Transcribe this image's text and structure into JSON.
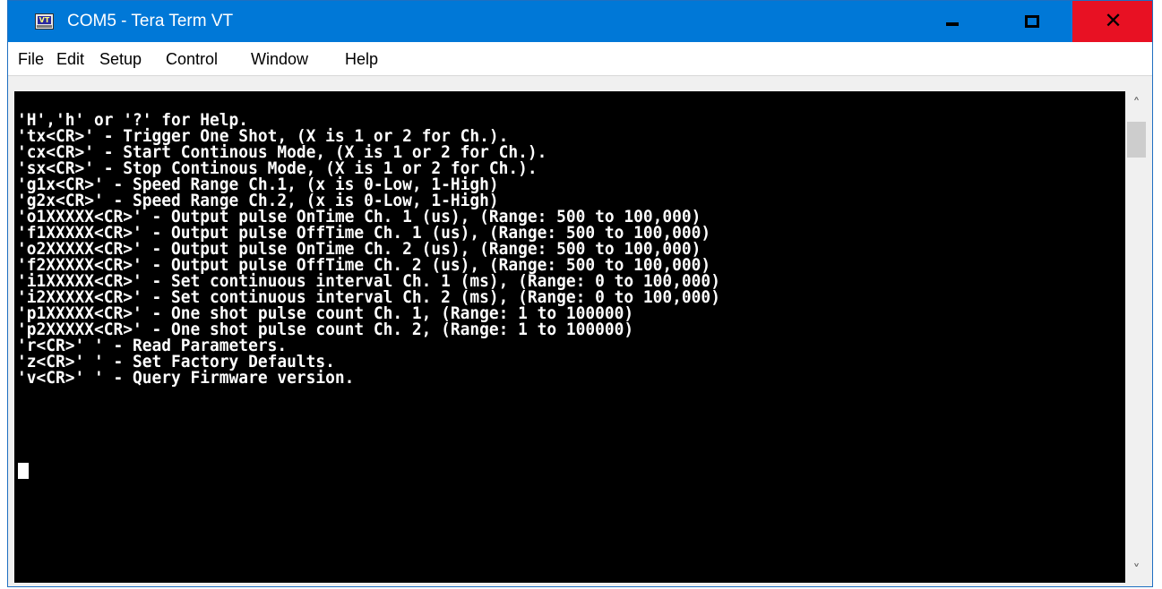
{
  "window": {
    "title": "COM5 - Tera Term VT",
    "icon": "tera-term-vt-icon",
    "icon_text": "VT",
    "controls": {
      "minimize": "minimize-icon",
      "maximize": "maximize-icon",
      "close": "close-icon",
      "close_glyph": "✕"
    },
    "colors": {
      "titlebar": "#0078d7",
      "close_button": "#e81123",
      "terminal_bg": "#000000",
      "terminal_fg": "#ffffff"
    }
  },
  "menu": {
    "items": [
      {
        "label": "File"
      },
      {
        "label": "Edit"
      },
      {
        "label": "Setup"
      },
      {
        "label": "Control"
      },
      {
        "label": "Window"
      },
      {
        "label": "Help"
      }
    ]
  },
  "terminal": {
    "lines": [
      "'H','h' or '?' for Help.",
      "'tx<CR>' - Trigger One Shot, (X is 1 or 2 for Ch.).",
      "'cx<CR>' - Start Continous Mode, (X is 1 or 2 for Ch.).",
      "'sx<CR>' - Stop Continous Mode, (X is 1 or 2 for Ch.).",
      "'g1x<CR>' - Speed Range Ch.1, (x is 0-Low, 1-High)",
      "'g2x<CR>' - Speed Range Ch.2, (x is 0-Low, 1-High)",
      "'o1XXXXX<CR>' - Output pulse OnTime Ch. 1 (us), (Range: 500 to 100,000)",
      "'f1XXXXX<CR>' - Output pulse OffTime Ch. 1 (us), (Range: 500 to 100,000)",
      "'o2XXXXX<CR>' - Output pulse OnTime Ch. 2 (us), (Range: 500 to 100,000)",
      "'f2XXXXX<CR>' - Output pulse OffTime Ch. 2 (us), (Range: 500 to 100,000)",
      "'i1XXXXX<CR>' - Set continuous interval Ch. 1 (ms), (Range: 0 to 100,000)",
      "'i2XXXXX<CR>' - Set continuous interval Ch. 2 (ms), (Range: 0 to 100,000)",
      "'p1XXXXX<CR>' - One shot pulse count Ch. 1, (Range: 1 to 100000)",
      "'p2XXXXX<CR>' - One shot pulse count Ch. 2, (Range: 1 to 100000)",
      "'r<CR>' ' - Read Parameters.",
      "'z<CR>' ' - Set Factory Defaults.",
      "'v<CR>' ' - Query Firmware version."
    ]
  },
  "scrollbar": {
    "up_icon": "chevron-up-icon",
    "down_icon": "chevron-down-icon",
    "up_glyph": "˄",
    "down_glyph": "˅"
  }
}
